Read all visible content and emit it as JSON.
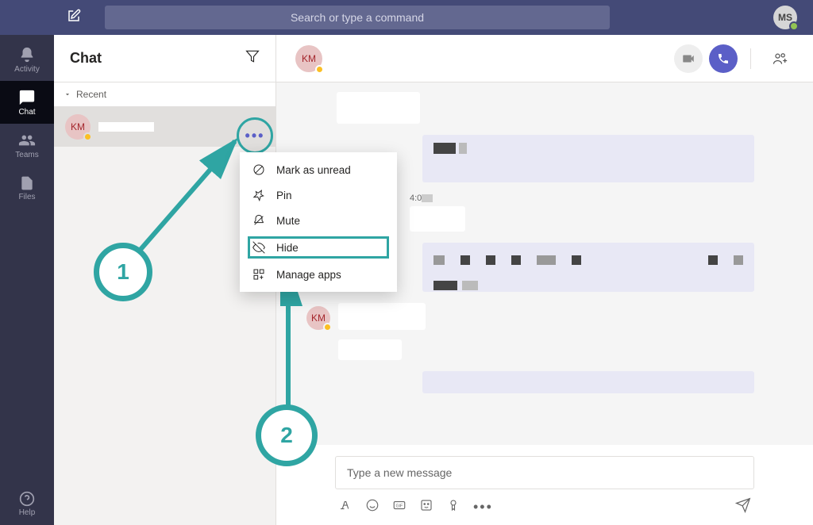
{
  "topbar": {
    "search_placeholder": "Search or type a command",
    "user_initials": "MS"
  },
  "rail": {
    "items": [
      {
        "label": "Activity"
      },
      {
        "label": "Chat"
      },
      {
        "label": "Teams"
      },
      {
        "label": "Files"
      }
    ],
    "help_label": "Help"
  },
  "chat_panel": {
    "title": "Chat",
    "recent_label": "Recent",
    "item_initials": "KM"
  },
  "context_menu": {
    "items": [
      {
        "label": "Mark as unread"
      },
      {
        "label": "Pin"
      },
      {
        "label": "Mute"
      },
      {
        "label": "Hide"
      },
      {
        "label": "Manage apps"
      }
    ]
  },
  "conversation": {
    "header_initials": "KM",
    "timestamp": "4:0",
    "message_avatar": "KM"
  },
  "compose": {
    "placeholder": "Type a new message"
  },
  "callouts": {
    "one": "1",
    "two": "2"
  }
}
